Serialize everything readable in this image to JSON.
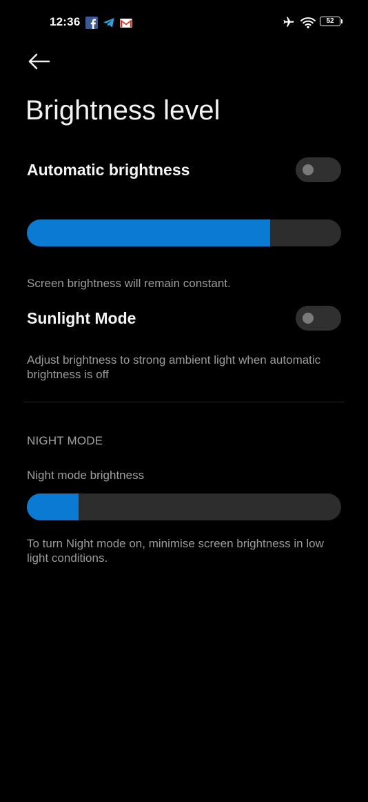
{
  "status_bar": {
    "time": "12:36",
    "battery": "52",
    "notification_icons": [
      "facebook-icon",
      "telegram-icon",
      "gmail-icon"
    ],
    "system_icons": [
      "airplane-mode-icon",
      "wifi-icon",
      "battery-icon"
    ]
  },
  "header": {
    "title": "Brightness level"
  },
  "automatic_brightness": {
    "label": "Automatic brightness",
    "enabled": false
  },
  "brightness_slider": {
    "level": 0.775,
    "description": "Screen brightness will remain constant."
  },
  "sunlight_mode": {
    "label": "Sunlight Mode",
    "enabled": false,
    "description": "Adjust brightness to strong ambient light when automatic brightness is off"
  },
  "night_mode": {
    "section_title": "NIGHT MODE",
    "slider_label": "Night mode brightness",
    "level": 0.165,
    "description": "To turn Night mode on, minimise screen brightness in low light conditions."
  },
  "colors": {
    "accent": "#0a7ad3",
    "background": "#000000",
    "track": "#2d2d2d"
  }
}
